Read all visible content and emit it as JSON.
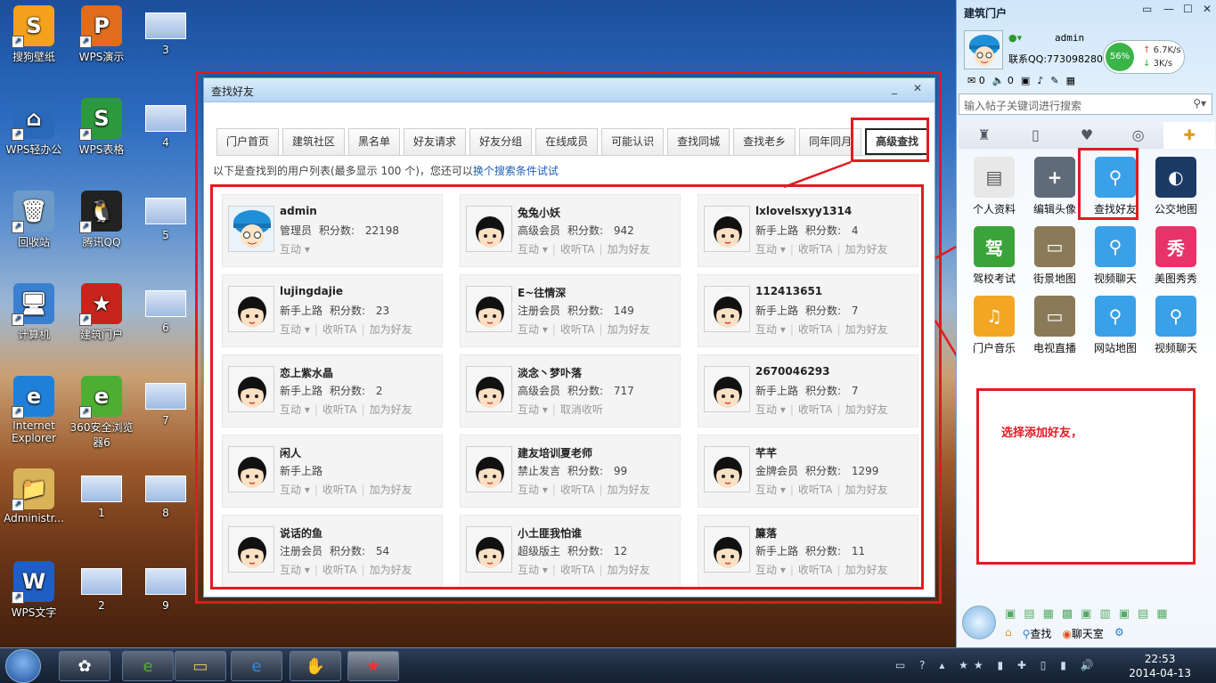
{
  "desktop": {
    "icons": [
      {
        "label": "搜狗壁纸",
        "color": "#f4a21c",
        "glyph": "S"
      },
      {
        "label": "WPS演示",
        "color": "#e06d1b",
        "glyph": "P"
      },
      {
        "label": "3",
        "color": "",
        "glyph": ""
      },
      {
        "label": "WPS轻办公",
        "color": "#2a68b9",
        "glyph": "⌂"
      },
      {
        "label": "WPS表格",
        "color": "#2c9a3c",
        "glyph": "S"
      },
      {
        "label": "4",
        "color": "",
        "glyph": ""
      },
      {
        "label": "回收站",
        "color": "#6d9bc9",
        "glyph": "🗑"
      },
      {
        "label": "腾讯QQ",
        "color": "#222222",
        "glyph": "🐧"
      },
      {
        "label": "5",
        "color": "",
        "glyph": ""
      },
      {
        "label": "计算机",
        "color": "#3b7fd0",
        "glyph": "🖥"
      },
      {
        "label": "建筑门户",
        "color": "#c8241c",
        "glyph": "★"
      },
      {
        "label": "6",
        "color": "",
        "glyph": ""
      },
      {
        "label": "Internet Explorer",
        "color": "#1f80d8",
        "glyph": "e"
      },
      {
        "label": "360安全浏览器6",
        "color": "#4caf32",
        "glyph": "e"
      },
      {
        "label": "7",
        "color": "",
        "glyph": ""
      },
      {
        "label": "Administr...",
        "color": "#d9b35a",
        "glyph": "📁"
      },
      {
        "label": "1",
        "color": "",
        "glyph": ""
      },
      {
        "label": "8",
        "color": "",
        "glyph": ""
      },
      {
        "label": "WPS文字",
        "color": "#1f5ec5",
        "glyph": "W"
      },
      {
        "label": "2",
        "color": "",
        "glyph": ""
      },
      {
        "label": "9",
        "color": "",
        "glyph": ""
      }
    ]
  },
  "dialog": {
    "title": "查找好友",
    "minimize": "_",
    "close": "✕",
    "tabs": [
      "门户首页",
      "建筑社区",
      "黑名单",
      "好友请求",
      "好友分组",
      "在线成员",
      "可能认识",
      "查找同城",
      "查找老乡",
      "同年同月",
      "高级查找"
    ],
    "active_tab": "高级查找",
    "hint_prefix": "以下是查找到的用户列表(最多显示  100 个)，您还可以",
    "hint_link": "换个搜索条件试试",
    "score_label": "积分数:",
    "users": [
      {
        "name": "admin",
        "level": "管理员",
        "score": "22198",
        "acts": [
          "互动"
        ]
      },
      {
        "name": "兔兔小妖",
        "level": "高级会员",
        "score": "942",
        "acts": [
          "互动",
          "收听TA",
          "加为好友"
        ]
      },
      {
        "name": "lxlovelsxyy1314",
        "level": "新手上路",
        "score": "4",
        "acts": [
          "互动",
          "收听TA",
          "加为好友"
        ]
      },
      {
        "name": "lujingdajie",
        "level": "新手上路",
        "score": "23",
        "acts": [
          "互动",
          "收听TA",
          "加为好友"
        ]
      },
      {
        "name": "E~往情深",
        "level": "注册会员",
        "score": "149",
        "acts": [
          "互动",
          "收听TA",
          "加为好友"
        ]
      },
      {
        "name": "112413651",
        "level": "新手上路",
        "score": "7",
        "acts": [
          "互动",
          "收听TA",
          "加为好友"
        ]
      },
      {
        "name": "恋上紫水晶",
        "level": "新手上路",
        "score": "2",
        "acts": [
          "互动",
          "收听TA",
          "加为好友"
        ]
      },
      {
        "name": "淡念丶梦卟落",
        "level": "高级会员",
        "score": "717",
        "acts": [
          "互动",
          "取消收听"
        ]
      },
      {
        "name": "2670046293",
        "level": "新手上路",
        "score": "7",
        "acts": [
          "互动",
          "收听TA",
          "加为好友"
        ]
      },
      {
        "name": "闲人",
        "level": "新手上路",
        "score": "",
        "acts": [
          "互动",
          "收听TA",
          "加为好友"
        ]
      },
      {
        "name": "建友培训夏老师",
        "level": "禁止发言",
        "score": "99",
        "acts": [
          "互动",
          "收听TA",
          "加为好友"
        ]
      },
      {
        "name": "芊芊",
        "level": "金牌会员",
        "score": "1299",
        "acts": [
          "互动",
          "收听TA",
          "加为好友"
        ]
      },
      {
        "name": "说话的鱼",
        "level": "注册会员",
        "score": "54",
        "acts": [
          "互动",
          "收听TA",
          "加为好友"
        ]
      },
      {
        "name": "小土匪我怕谁",
        "level": "超级版主",
        "score": "12",
        "acts": [
          "互动",
          "收听TA",
          "加为好友"
        ]
      },
      {
        "name": "簾落",
        "level": "新手上路",
        "score": "11",
        "acts": [
          "互动",
          "收听TA",
          "加为好友"
        ]
      }
    ]
  },
  "panel": {
    "title": "建筑门户",
    "username": "admin",
    "qq": "联系QQ:773098280",
    "percent": "56%",
    "up_speed": "6.7K/s",
    "down_speed": "3K/s",
    "mail_count": "0",
    "sound_count": "0",
    "search_placeholder": "输入帖子关键词进行搜索",
    "apps": [
      {
        "label": "个人资料",
        "color": "#e8e8e8",
        "glyph": "▤"
      },
      {
        "label": "编辑头像",
        "color": "#5f6b78",
        "glyph": "+"
      },
      {
        "label": "查找好友",
        "color": "#3aa0e8",
        "glyph": "⚲"
      },
      {
        "label": "公交地图",
        "color": "#1c3a66",
        "glyph": "◐"
      },
      {
        "label": "驾校考试",
        "color": "#3aa43a",
        "glyph": "驾"
      },
      {
        "label": "街景地图",
        "color": "#8a7a58",
        "glyph": "▭"
      },
      {
        "label": "视频聊天",
        "color": "#3aa0e8",
        "glyph": "⚲"
      },
      {
        "label": "美图秀秀",
        "color": "#e8336a",
        "glyph": "秀"
      },
      {
        "label": "门户音乐",
        "color": "#f3a623",
        "glyph": "♫"
      },
      {
        "label": "电视直播",
        "color": "#8a7a58",
        "glyph": "▭"
      },
      {
        "label": "网站地图",
        "color": "#3aa0e8",
        "glyph": "⚲"
      },
      {
        "label": "视频聊天",
        "color": "#3aa0e8",
        "glyph": "⚲"
      }
    ],
    "bottom_find": "查找",
    "bottom_chat": "聊天室"
  },
  "annotation": "选择添加好友，",
  "taskbar": {
    "time": "22:53",
    "date": "2014-04-13"
  }
}
